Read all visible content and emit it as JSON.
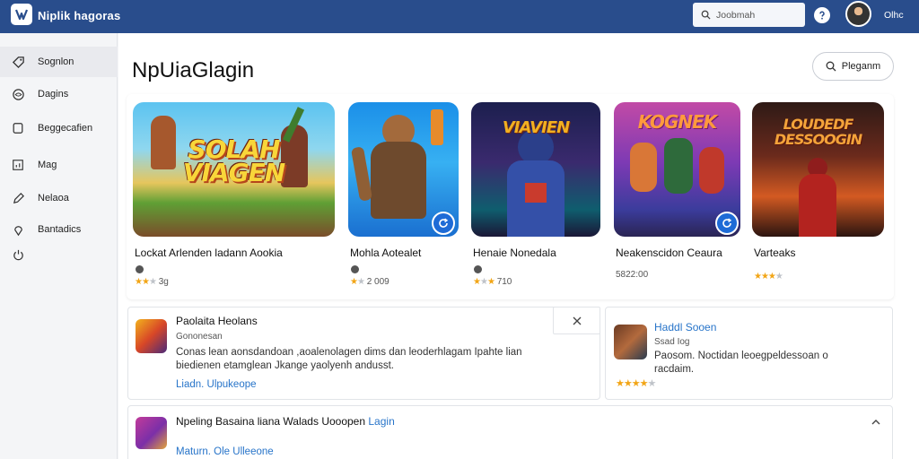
{
  "header": {
    "brand": "Niplik hagoras",
    "search_text": "Joobmah",
    "user_label": "Olhc",
    "colors": {
      "bar": "#294d8c",
      "accent": "#1e6bd6",
      "link": "#2774c9",
      "star": "#f2a516"
    }
  },
  "sidebar": {
    "items": [
      {
        "label": "Sognlon",
        "icon": "tag-icon"
      },
      {
        "label": "Dagins",
        "icon": "eye-icon"
      },
      {
        "label": "Beggecafien",
        "icon": "square-icon"
      },
      {
        "label": "Mag",
        "icon": "chart-icon"
      },
      {
        "label": "Nelaoa",
        "icon": "pen-icon"
      },
      {
        "label": "Bantadics",
        "icon": "location-icon"
      },
      {
        "label": "",
        "icon": "power-icon"
      }
    ]
  },
  "main": {
    "title": "NpUiaGlagin",
    "program_button": "Pleganm",
    "games": [
      {
        "art_text": "SOLAH\nVIAGEN",
        "name": "Lockat Arlenden ladann Aookia",
        "meta": "3g",
        "rating": 3
      },
      {
        "art_text": "",
        "name": "Mohla Aotealet",
        "meta": "2 009",
        "rating": 1
      },
      {
        "art_text": "VIAVIEN",
        "name": "Henaie Nonedala",
        "meta": "710",
        "rating": 2
      },
      {
        "art_text": "KOGNEK",
        "name": "Neakenscidon Ceaura",
        "meta": "5822:00",
        "rating": 0
      },
      {
        "art_text": "LOUDEDF\nDESSOOGIN",
        "name": "Varteaks",
        "meta": "",
        "rating": 4
      }
    ],
    "featured": {
      "name": "Paolaita Heolans",
      "sub": "Gononesan",
      "desc_line1": "Conas lean aonsdandoan ,aoalenolagen dims dan leoderhlagam Ipahte lian",
      "desc_line2": "biedienen etamglean Jkange yaolyenh andusst.",
      "link": "Liadn. Ulpukeope"
    },
    "side_card": {
      "name": "Haddl Sooen",
      "sub": "Ssad Iog",
      "desc_line1": "Paosom. Noctidan leoegpeldessoan o",
      "desc_line2": "racdaim.",
      "rating": 4
    },
    "bottom_card": {
      "name": "Npeling Basaina liana Walads Uooopen",
      "name_link": "Lagin",
      "link": "Maturn. Ole Ulleeone"
    }
  }
}
